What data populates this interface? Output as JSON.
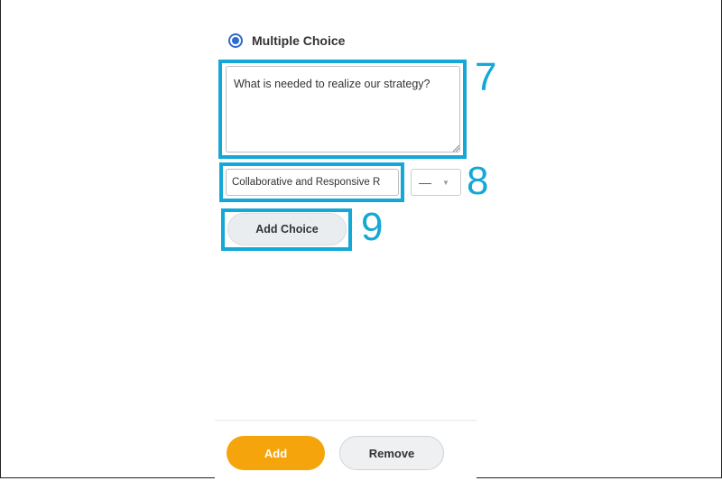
{
  "question_type": {
    "label": "Multiple Choice",
    "selected": true
  },
  "question": {
    "text": "What is needed to realize our strategy?"
  },
  "choice": {
    "value": "Collaborative and Responsive R",
    "select_value": "—"
  },
  "add_choice_label": "Add Choice",
  "annotations": {
    "step7": "7",
    "step8": "8",
    "step9": "9"
  },
  "footer": {
    "add_label": "Add",
    "remove_label": "Remove"
  },
  "colors": {
    "highlight": "#14a8d6",
    "primary_button": "#f5a40c",
    "radio": "#2d6bd1"
  }
}
